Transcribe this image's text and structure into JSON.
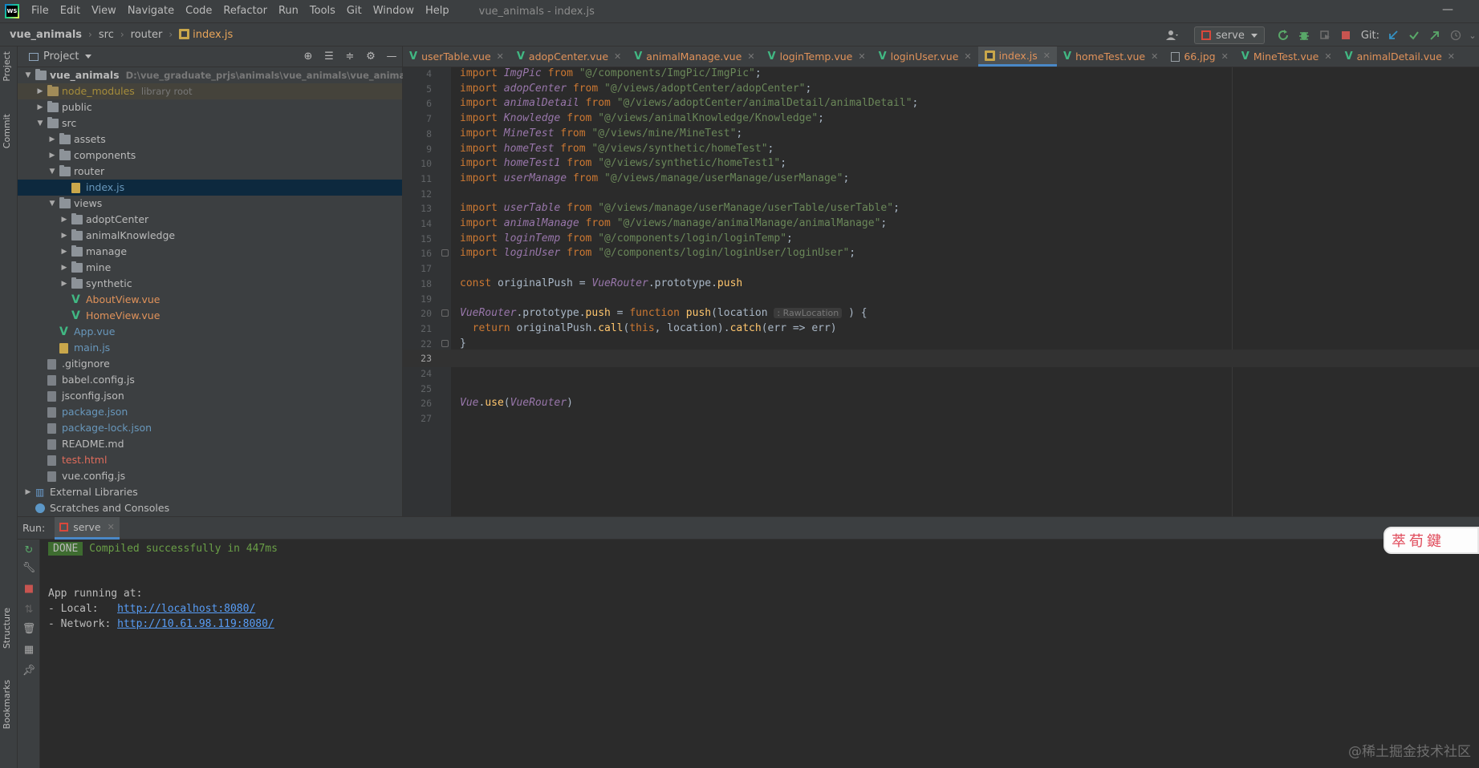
{
  "window": {
    "menu": [
      "File",
      "Edit",
      "View",
      "Navigate",
      "Code",
      "Refactor",
      "Run",
      "Tools",
      "Git",
      "Window",
      "Help"
    ],
    "title": "vue_animals - index.js",
    "minimize": "—"
  },
  "breadcrumb": {
    "project": "vue_animals",
    "parts": [
      "src",
      "router"
    ],
    "file": "index.js",
    "separator": "›"
  },
  "toolbar": {
    "run_config": "serve",
    "git_label": "Git:"
  },
  "stripe": {
    "project_tab": "Project",
    "commit_tab": "Commit",
    "structure_tab": "Structure",
    "bookmarks_tab": "Bookmarks"
  },
  "project_panel": {
    "title": "Project",
    "tree": [
      {
        "label": "vue_animals",
        "path": "D:\\vue_graduate_prjs\\animals\\vue_animals\\vue_animals",
        "depth": 0,
        "type": "folder",
        "expanded": true,
        "color": "bold"
      },
      {
        "label": "node_modules",
        "path": "library root",
        "depth": 1,
        "type": "folder-orange",
        "expanded": false,
        "color": "ignored",
        "lib": true
      },
      {
        "label": "public",
        "depth": 1,
        "type": "folder",
        "expanded": false,
        "color": "default"
      },
      {
        "label": "src",
        "depth": 1,
        "type": "folder",
        "expanded": true,
        "color": "default"
      },
      {
        "label": "assets",
        "depth": 2,
        "type": "folder",
        "expanded": false,
        "color": "default"
      },
      {
        "label": "components",
        "depth": 2,
        "type": "folder",
        "expanded": false,
        "color": "default"
      },
      {
        "label": "router",
        "depth": 2,
        "type": "folder",
        "expanded": true,
        "color": "default"
      },
      {
        "label": "index.js",
        "depth": 3,
        "type": "js",
        "color": "modified",
        "selected": true
      },
      {
        "label": "views",
        "depth": 2,
        "type": "folder",
        "expanded": true,
        "color": "default"
      },
      {
        "label": "adoptCenter",
        "depth": 3,
        "type": "folder",
        "expanded": false,
        "color": "default"
      },
      {
        "label": "animalKnowledge",
        "depth": 3,
        "type": "folder",
        "expanded": false,
        "color": "default"
      },
      {
        "label": "manage",
        "depth": 3,
        "type": "folder",
        "expanded": false,
        "color": "default"
      },
      {
        "label": "mine",
        "depth": 3,
        "type": "folder",
        "expanded": false,
        "color": "default"
      },
      {
        "label": "synthetic",
        "depth": 3,
        "type": "folder",
        "expanded": false,
        "color": "default"
      },
      {
        "label": "AboutView.vue",
        "depth": 3,
        "type": "vue",
        "color": "orange"
      },
      {
        "label": "HomeView.vue",
        "depth": 3,
        "type": "vue",
        "color": "orange"
      },
      {
        "label": "App.vue",
        "depth": 2,
        "type": "vue",
        "color": "modified"
      },
      {
        "label": "main.js",
        "depth": 2,
        "type": "js",
        "color": "modified"
      },
      {
        "label": ".gitignore",
        "depth": 1,
        "type": "file",
        "color": "default"
      },
      {
        "label": "babel.config.js",
        "depth": 1,
        "type": "file",
        "color": "default"
      },
      {
        "label": "jsconfig.json",
        "depth": 1,
        "type": "file",
        "color": "default"
      },
      {
        "label": "package.json",
        "depth": 1,
        "type": "file",
        "color": "modified"
      },
      {
        "label": "package-lock.json",
        "depth": 1,
        "type": "file",
        "color": "modified"
      },
      {
        "label": "README.md",
        "depth": 1,
        "type": "file",
        "color": "default"
      },
      {
        "label": "test.html",
        "depth": 1,
        "type": "file",
        "color": "red"
      },
      {
        "label": "vue.config.js",
        "depth": 1,
        "type": "file",
        "color": "default"
      },
      {
        "label": "External Libraries",
        "depth": 0,
        "type": "lib",
        "expanded": false,
        "color": "default"
      },
      {
        "label": "Scratches and Consoles",
        "depth": 0,
        "type": "scratch",
        "color": "default"
      }
    ]
  },
  "editor_tabs": [
    {
      "label": "userTable.vue",
      "icon": "vue"
    },
    {
      "label": "adopCenter.vue",
      "icon": "vue"
    },
    {
      "label": "animalManage.vue",
      "icon": "vue"
    },
    {
      "label": "loginTemp.vue",
      "icon": "vue"
    },
    {
      "label": "loginUser.vue",
      "icon": "vue"
    },
    {
      "label": "index.js",
      "icon": "js",
      "active": true
    },
    {
      "label": "homeTest.vue",
      "icon": "vue"
    },
    {
      "label": "66.jpg",
      "icon": "img"
    },
    {
      "label": "MineTest.vue",
      "icon": "vue"
    },
    {
      "label": "animalDetail.vue",
      "icon": "vue"
    }
  ],
  "editor": {
    "current_line": 23,
    "fold_lines": [
      16,
      20,
      22
    ],
    "lines": [
      {
        "n": 4,
        "tokens": [
          [
            "kw",
            "import "
          ],
          [
            "id",
            "ImgPic"
          ],
          [
            "kw",
            " from "
          ],
          [
            "str",
            "\"@/components/ImgPic/ImgPic\""
          ],
          [
            "plain",
            ";"
          ]
        ]
      },
      {
        "n": 5,
        "tokens": [
          [
            "kw",
            "import "
          ],
          [
            "id",
            "adopCenter"
          ],
          [
            "kw",
            " from "
          ],
          [
            "str",
            "\"@/views/adoptCenter/adopCenter\""
          ],
          [
            "plain",
            ";"
          ]
        ]
      },
      {
        "n": 6,
        "tokens": [
          [
            "kw",
            "import "
          ],
          [
            "id",
            "animalDetail"
          ],
          [
            "kw",
            " from "
          ],
          [
            "str",
            "\"@/views/adoptCenter/animalDetail/animalDetail\""
          ],
          [
            "plain",
            ";"
          ]
        ]
      },
      {
        "n": 7,
        "tokens": [
          [
            "kw",
            "import "
          ],
          [
            "id",
            "Knowledge"
          ],
          [
            "kw",
            " from "
          ],
          [
            "str",
            "\"@/views/animalKnowledge/Knowledge\""
          ],
          [
            "plain",
            ";"
          ]
        ]
      },
      {
        "n": 8,
        "tokens": [
          [
            "kw",
            "import "
          ],
          [
            "id",
            "MineTest"
          ],
          [
            "kw",
            " from "
          ],
          [
            "str",
            "\"@/views/mine/MineTest\""
          ],
          [
            "plain",
            ";"
          ]
        ]
      },
      {
        "n": 9,
        "tokens": [
          [
            "kw",
            "import "
          ],
          [
            "id",
            "homeTest"
          ],
          [
            "kw",
            " from "
          ],
          [
            "str",
            "\"@/views/synthetic/homeTest\""
          ],
          [
            "plain",
            ";"
          ]
        ]
      },
      {
        "n": 10,
        "tokens": [
          [
            "kw",
            "import "
          ],
          [
            "id",
            "homeTest1"
          ],
          [
            "kw",
            " from "
          ],
          [
            "str",
            "\"@/views/synthetic/homeTest1\""
          ],
          [
            "plain",
            ";"
          ]
        ]
      },
      {
        "n": 11,
        "tokens": [
          [
            "kw",
            "import "
          ],
          [
            "id",
            "userManage"
          ],
          [
            "kw",
            " from "
          ],
          [
            "str",
            "\"@/views/manage/userManage/userManage\""
          ],
          [
            "plain",
            ";"
          ]
        ]
      },
      {
        "n": 12,
        "tokens": []
      },
      {
        "n": 13,
        "tokens": [
          [
            "kw",
            "import "
          ],
          [
            "id",
            "userTable"
          ],
          [
            "kw",
            " from "
          ],
          [
            "str",
            "\"@/views/manage/userManage/userTable/userTable\""
          ],
          [
            "plain",
            ";"
          ]
        ]
      },
      {
        "n": 14,
        "tokens": [
          [
            "kw",
            "import "
          ],
          [
            "id",
            "animalManage"
          ],
          [
            "kw",
            " from "
          ],
          [
            "str",
            "\"@/views/manage/animalManage/animalManage\""
          ],
          [
            "plain",
            ";"
          ]
        ]
      },
      {
        "n": 15,
        "tokens": [
          [
            "kw",
            "import "
          ],
          [
            "id",
            "loginTemp"
          ],
          [
            "kw",
            " from "
          ],
          [
            "str",
            "\"@/components/login/loginTemp\""
          ],
          [
            "plain",
            ";"
          ]
        ]
      },
      {
        "n": 16,
        "tokens": [
          [
            "kw",
            "import "
          ],
          [
            "id",
            "loginUser"
          ],
          [
            "kw",
            " from "
          ],
          [
            "str",
            "\"@/components/login/loginUser/loginUser\""
          ],
          [
            "plain",
            ";"
          ]
        ]
      },
      {
        "n": 17,
        "tokens": []
      },
      {
        "n": 18,
        "tokens": [
          [
            "kw",
            "const "
          ],
          [
            "plain",
            "originalPush = "
          ],
          [
            "id",
            "VueRouter"
          ],
          [
            "plain",
            ".prototype."
          ],
          [
            "fn",
            "push"
          ]
        ]
      },
      {
        "n": 19,
        "tokens": []
      },
      {
        "n": 20,
        "tokens": [
          [
            "id",
            "VueRouter"
          ],
          [
            "plain",
            ".prototype."
          ],
          [
            "fn",
            "push"
          ],
          [
            "plain",
            " = "
          ],
          [
            "kw",
            "function "
          ],
          [
            "fn",
            "push"
          ],
          [
            "plain",
            "(location "
          ],
          [
            "hint",
            ": RawLocation"
          ],
          [
            "plain",
            " ) {"
          ]
        ]
      },
      {
        "n": 21,
        "tokens": [
          [
            "plain",
            "  "
          ],
          [
            "kw",
            "return "
          ],
          [
            "plain",
            "originalPush."
          ],
          [
            "fn",
            "call"
          ],
          [
            "plain",
            "("
          ],
          [
            "kw",
            "this"
          ],
          [
            "plain",
            ", location)."
          ],
          [
            "fn",
            "catch"
          ],
          [
            "plain",
            "(err => err)"
          ]
        ]
      },
      {
        "n": 22,
        "tokens": [
          [
            "plain",
            "}"
          ]
        ]
      },
      {
        "n": 23,
        "tokens": []
      },
      {
        "n": 24,
        "tokens": []
      },
      {
        "n": 25,
        "tokens": []
      },
      {
        "n": 26,
        "tokens": [
          [
            "id",
            "Vue"
          ],
          [
            "plain",
            "."
          ],
          [
            "fn",
            "use"
          ],
          [
            "plain",
            "("
          ],
          [
            "id",
            "VueRouter"
          ],
          [
            "plain",
            ")"
          ]
        ]
      },
      {
        "n": 27,
        "tokens": []
      }
    ]
  },
  "run_panel": {
    "label": "Run:",
    "tab": "serve",
    "done_badge": "DONE",
    "compiled": "Compiled successfully in 447ms",
    "running": "App running at:",
    "local_label": "- Local:   ",
    "local_url": "http://localhost:8080/",
    "network_label": "- Network: ",
    "network_url": "http://10.61.98.119:8080/"
  },
  "sticker": {
    "text": "萃荀鍵"
  },
  "watermark": "@稀土掘金技术社区",
  "colors": {
    "accent": "#4a88c7",
    "keyword": "#cc7832",
    "string": "#6a8759",
    "identifier": "#9876aa",
    "function": "#ffc66d"
  }
}
